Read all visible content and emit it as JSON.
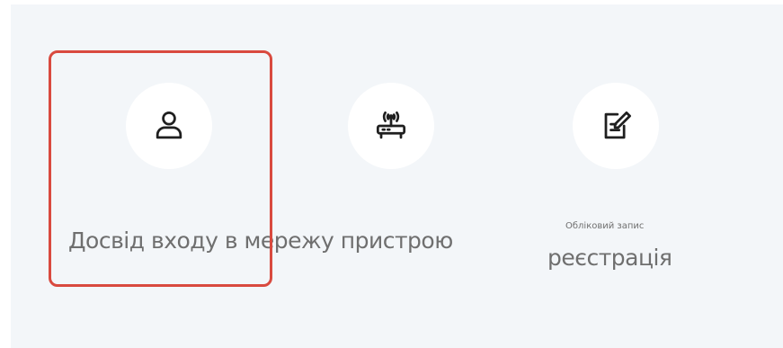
{
  "cards": [
    {
      "icon": "user-icon",
      "label": "Досвід входу в мережу пристрою",
      "selected": true
    },
    {
      "icon": "router-icon",
      "label": "",
      "selected": false
    },
    {
      "icon": "register-edit-icon",
      "sublabel": "Обліковий запис",
      "label": "реєстрація",
      "selected": false
    }
  ],
  "colors": {
    "highlight": "#d94a3f",
    "panel_background": "#f3f6f9",
    "icon_background": "#ffffff",
    "text": "#6f6f6f"
  }
}
